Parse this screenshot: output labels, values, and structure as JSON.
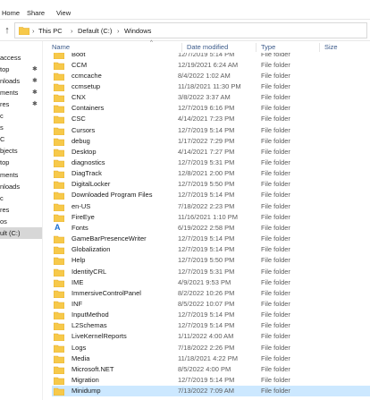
{
  "ribbon": {
    "tabs": [
      "Home",
      "Share",
      "View"
    ]
  },
  "address": {
    "crumbs": [
      "This PC",
      "Default (C:)",
      "Windows"
    ]
  },
  "navigation": {
    "items": [
      {
        "label": "access",
        "pinned": false
      },
      {
        "label": "top",
        "pinned": true
      },
      {
        "label": "nloads",
        "pinned": true
      },
      {
        "label": "ments",
        "pinned": true
      },
      {
        "label": "res",
        "pinned": true
      },
      {
        "label": "c",
        "pinned": false
      },
      {
        "label": "s",
        "pinned": false
      },
      {
        "label": "C",
        "pinned": false
      },
      {
        "label": "bjects",
        "pinned": false
      },
      {
        "label": "top",
        "pinned": false
      },
      {
        "label": "ments",
        "pinned": false
      },
      {
        "label": "nloads",
        "pinned": false
      },
      {
        "label": "c",
        "pinned": false
      },
      {
        "label": "res",
        "pinned": false
      },
      {
        "label": "os",
        "pinned": false
      },
      {
        "label": "ult (C:)",
        "pinned": false,
        "selected": true
      }
    ]
  },
  "columns": {
    "name": "Name",
    "date": "Date modified",
    "type": "Type",
    "size": "Size"
  },
  "files": [
    {
      "name": "Boot",
      "date": "12/7/2019 5:14 PM",
      "type": "File folder"
    },
    {
      "name": "CCM",
      "date": "12/19/2021 6:24 AM",
      "type": "File folder"
    },
    {
      "name": "ccmcache",
      "date": "8/4/2022 1:02 AM",
      "type": "File folder"
    },
    {
      "name": "ccmsetup",
      "date": "11/18/2021 11:30 PM",
      "type": "File folder"
    },
    {
      "name": "CNX",
      "date": "3/8/2022 3:37 AM",
      "type": "File folder"
    },
    {
      "name": "Containers",
      "date": "12/7/2019 6:16 PM",
      "type": "File folder"
    },
    {
      "name": "CSC",
      "date": "4/14/2021 7:23 PM",
      "type": "File folder"
    },
    {
      "name": "Cursors",
      "date": "12/7/2019 5:14 PM",
      "type": "File folder"
    },
    {
      "name": "debug",
      "date": "1/17/2022 7:29 PM",
      "type": "File folder"
    },
    {
      "name": "Desktop",
      "date": "4/14/2021 7:27 PM",
      "type": "File folder"
    },
    {
      "name": "diagnostics",
      "date": "12/7/2019 5:31 PM",
      "type": "File folder"
    },
    {
      "name": "DiagTrack",
      "date": "12/8/2021 2:00 PM",
      "type": "File folder"
    },
    {
      "name": "DigitalLocker",
      "date": "12/7/2019 5:50 PM",
      "type": "File folder"
    },
    {
      "name": "Downloaded Program Files",
      "date": "12/7/2019 5:14 PM",
      "type": "File folder"
    },
    {
      "name": "en-US",
      "date": "7/18/2022 2:23 PM",
      "type": "File folder"
    },
    {
      "name": "FireEye",
      "date": "11/16/2021 1:10 PM",
      "type": "File folder"
    },
    {
      "name": "Fonts",
      "date": "6/19/2022 2:58 PM",
      "type": "File folder"
    },
    {
      "name": "GameBarPresenceWriter",
      "date": "12/7/2019 5:14 PM",
      "type": "File folder"
    },
    {
      "name": "Globalization",
      "date": "12/7/2019 5:14 PM",
      "type": "File folder"
    },
    {
      "name": "Help",
      "date": "12/7/2019 5:50 PM",
      "type": "File folder"
    },
    {
      "name": "IdentityCRL",
      "date": "12/7/2019 5:31 PM",
      "type": "File folder"
    },
    {
      "name": "IME",
      "date": "4/9/2021 9:53 PM",
      "type": "File folder"
    },
    {
      "name": "ImmersiveControlPanel",
      "date": "8/2/2022 10:26 PM",
      "type": "File folder"
    },
    {
      "name": "INF",
      "date": "8/5/2022 10:07 PM",
      "type": "File folder"
    },
    {
      "name": "InputMethod",
      "date": "12/7/2019 5:14 PM",
      "type": "File folder"
    },
    {
      "name": "L2Schemas",
      "date": "12/7/2019 5:14 PM",
      "type": "File folder"
    },
    {
      "name": "LiveKernelReports",
      "date": "1/11/2022 4:00 AM",
      "type": "File folder"
    },
    {
      "name": "Logs",
      "date": "7/18/2022 2:26 PM",
      "type": "File folder"
    },
    {
      "name": "Media",
      "date": "11/18/2021 4:22 PM",
      "type": "File folder"
    },
    {
      "name": "Microsoft.NET",
      "date": "8/5/2022 4:00 PM",
      "type": "File folder"
    },
    {
      "name": "Migration",
      "date": "12/7/2019 5:14 PM",
      "type": "File folder"
    },
    {
      "name": "Minidump",
      "date": "7/13/2022 7:09 AM",
      "type": "File folder",
      "selected": true
    }
  ],
  "colors": {
    "folder": "#f7c94a",
    "folder_dark": "#e2a92a",
    "selected_row": "#cce8ff",
    "header_text": "#3b5a8a"
  }
}
